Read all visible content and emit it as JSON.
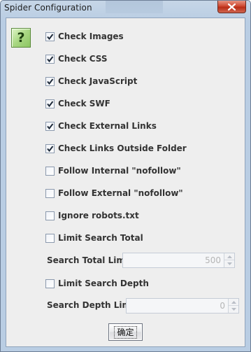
{
  "window": {
    "title": "Spider Configuration",
    "close_icon": "close-icon"
  },
  "help": {
    "glyph": "?",
    "icon": "help-icon"
  },
  "options": [
    {
      "label": "Check Images",
      "checked": true
    },
    {
      "label": "Check CSS",
      "checked": true
    },
    {
      "label": "Check JavaScript",
      "checked": true
    },
    {
      "label": "Check SWF",
      "checked": true
    },
    {
      "label": "Check External Links",
      "checked": true
    },
    {
      "label": "Check Links Outside Folder",
      "checked": true
    },
    {
      "label": "Follow Internal \"nofollow\"",
      "checked": false
    },
    {
      "label": "Follow External \"nofollow\"",
      "checked": false
    },
    {
      "label": "Ignore robots.txt",
      "checked": false
    },
    {
      "label": "Limit Search Total",
      "checked": false
    }
  ],
  "search_total": {
    "label": "Search Total Limit",
    "value": "500",
    "enabled": false
  },
  "limit_depth": {
    "label": "Limit Search Depth",
    "checked": false
  },
  "search_depth": {
    "label": "Search Depth Limit",
    "value": "0",
    "enabled": false
  },
  "ok_button": {
    "label": "确定"
  },
  "colors": {
    "client_bg": "#eeeeee",
    "label_text": "#333333",
    "close_red": "#c8412a",
    "help_green": "#8cc662"
  }
}
